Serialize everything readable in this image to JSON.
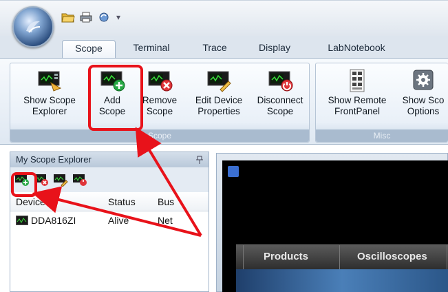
{
  "ribbon_tabs": [
    "Scope",
    "Terminal",
    "Trace",
    "Display",
    "LabNotebook"
  ],
  "active_tab": "Scope",
  "ribbon_groups": [
    {
      "label": "Scope",
      "buttons": [
        "Show Scope\nExplorer",
        "Add\nScope",
        "Remove\nScope",
        "Edit Device\nProperties",
        "Disconnect\nScope"
      ]
    },
    {
      "label": "Misc",
      "buttons": [
        "Show Remote\nFrontPanel",
        "Show Sco\nOptions"
      ]
    }
  ],
  "explorer": {
    "title": "My Scope Explorer",
    "columns": [
      "Device",
      "Status",
      "Bus"
    ],
    "rows": [
      {
        "device": "DDA816ZI",
        "status": "Alive",
        "bus": "Net"
      }
    ]
  },
  "front_panel": {
    "nav_items": [
      "Products",
      "Oscilloscopes"
    ]
  },
  "annotation_color": "#e8121a",
  "icons": [
    "application-orb-icon",
    "open-folder-icon",
    "print-icon",
    "refresh-icon",
    "dropdown-arrow-icon",
    "scope-explorer-icon",
    "add-scope-icon",
    "remove-scope-icon",
    "edit-device-icon",
    "disconnect-scope-icon",
    "remote-frontpanel-icon",
    "options-gear-icon",
    "pin-icon",
    "scope-device-icon"
  ]
}
